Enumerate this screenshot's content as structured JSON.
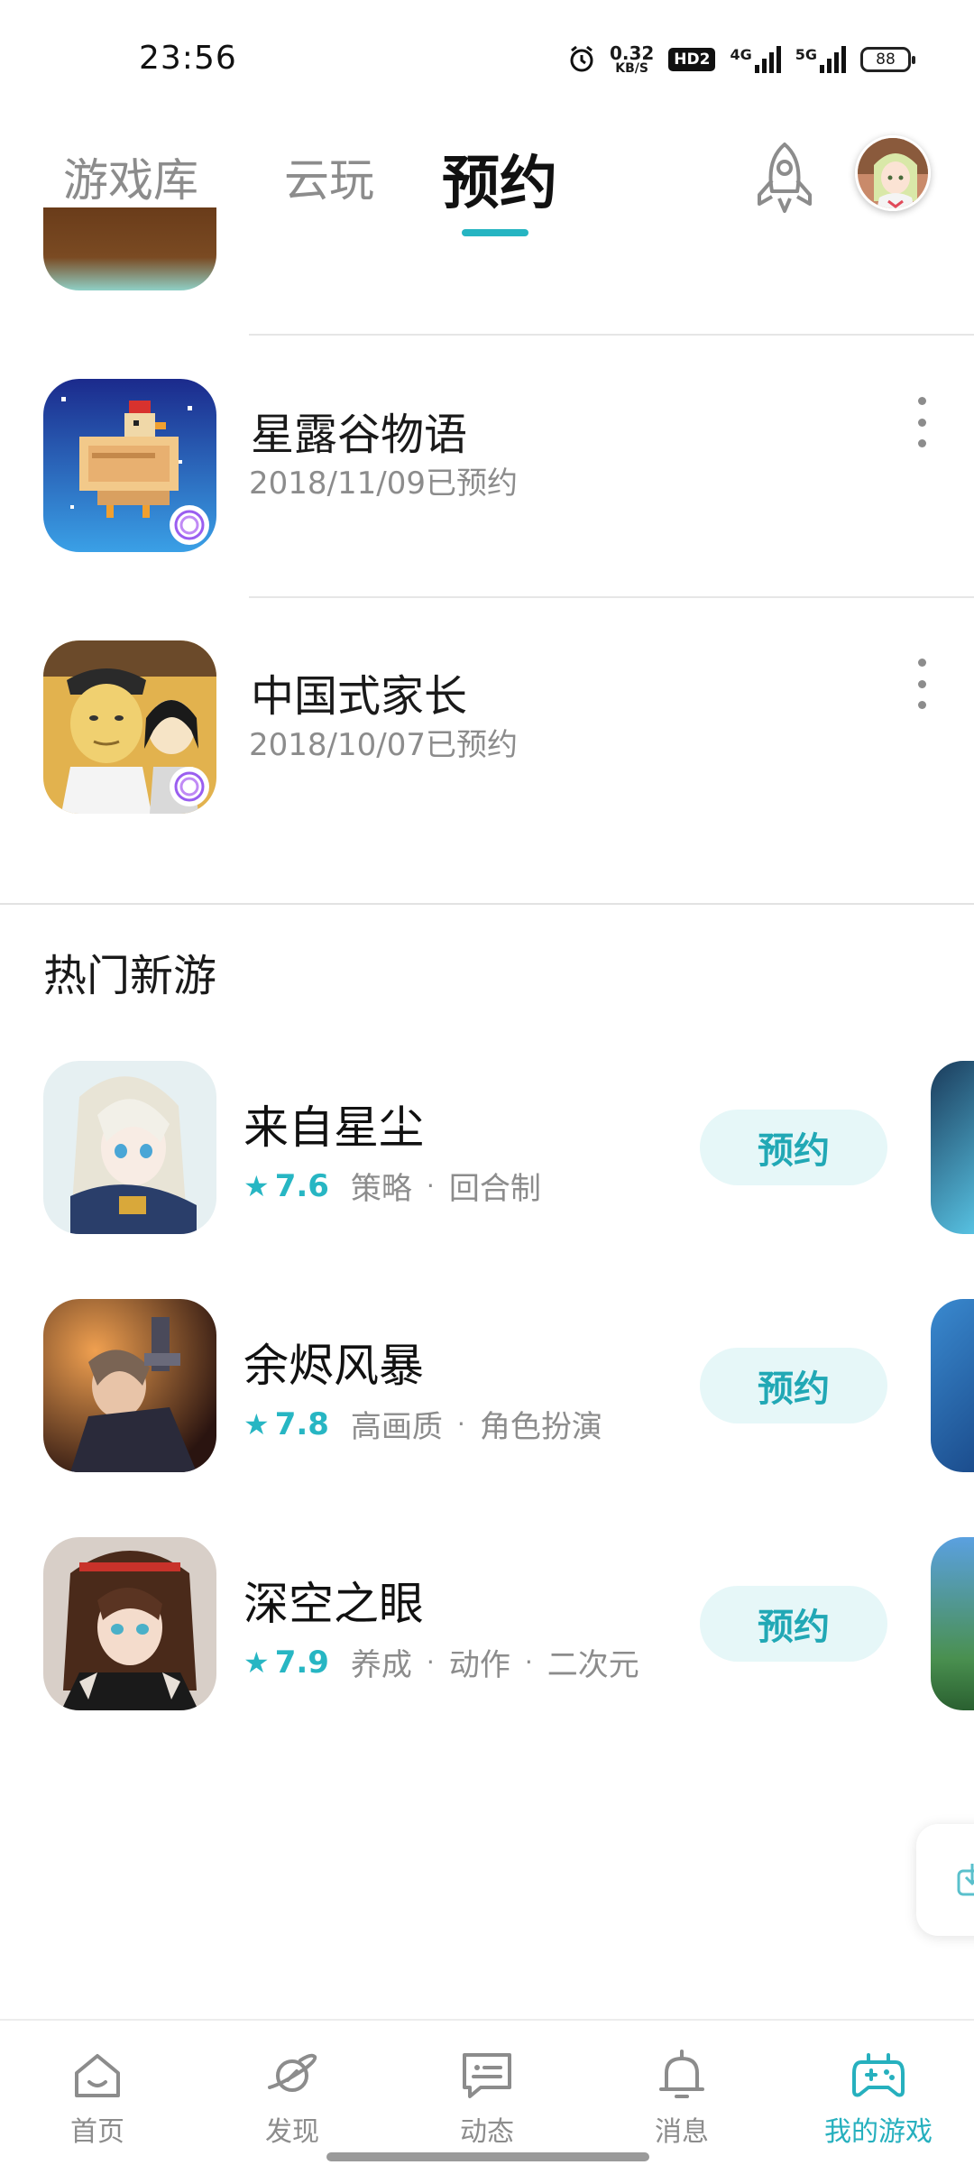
{
  "status_bar": {
    "time": "23:56",
    "net_speed_value": "0.32",
    "net_speed_unit": "KB/S",
    "hd_badge": "HD2",
    "net1_label": "4G",
    "net2_label": "5G",
    "battery": "88"
  },
  "top_tabs": {
    "tabs": [
      {
        "label": "游戏库"
      },
      {
        "label": "云玩"
      },
      {
        "label": "预约"
      }
    ],
    "active_tab": "预约",
    "accent_color": "#26b5c2"
  },
  "reserved_games": [
    {
      "title": "星露谷物语",
      "date": "2018/11/09已预约"
    },
    {
      "title": "中国式家长",
      "date": "2018/10/07已预约"
    }
  ],
  "hot_section": {
    "title": "热门新游",
    "items": [
      {
        "title": "来自星尘",
        "score": "7.6",
        "tags": [
          "策略",
          "回合制"
        ],
        "button": "预约"
      },
      {
        "title": "余烬风暴",
        "score": "7.8",
        "tags": [
          "高画质",
          "角色扮演"
        ],
        "button": "预约"
      },
      {
        "title": "深空之眼",
        "score": "7.9",
        "tags": [
          "养成",
          "动作",
          "二次元"
        ],
        "button": "预约"
      }
    ]
  },
  "bottom_nav": {
    "items": [
      {
        "label": "首页",
        "icon": "home-icon"
      },
      {
        "label": "发现",
        "icon": "planet-icon"
      },
      {
        "label": "动态",
        "icon": "chat-icon"
      },
      {
        "label": "消息",
        "icon": "bell-icon"
      },
      {
        "label": "我的游戏",
        "icon": "gamepad-icon"
      }
    ],
    "active": "我的游戏"
  }
}
